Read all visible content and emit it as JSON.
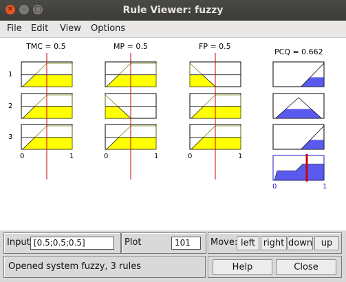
{
  "window": {
    "title": "Rule Viewer: fuzzy"
  },
  "menu": [
    "File",
    "Edit",
    "View",
    "Options"
  ],
  "inputs": [
    {
      "label": "TMC = 0.5",
      "value": 0.5
    },
    {
      "label": "MP = 0.5",
      "value": 0.5
    },
    {
      "label": "FP = 0.5",
      "value": 0.5
    }
  ],
  "output": {
    "label": "PCQ = 0.662",
    "value": 0.662
  },
  "rules": [
    "1",
    "2",
    "3"
  ],
  "axis_ticks": [
    "0",
    "1"
  ],
  "output_ticks": [
    "0",
    "1"
  ],
  "membership": {
    "input_mf_by_rule": [
      [
        "rising",
        "rising",
        "falling"
      ],
      [
        "rising",
        "falling",
        "rising"
      ],
      [
        "rising",
        "rising",
        "rising"
      ]
    ],
    "output_mf_by_rule": [
      "high",
      "mid",
      "high"
    ]
  },
  "colors": {
    "input_fill": "#ffff00",
    "output_fill": "#5a5aee",
    "marker": "#cc0000",
    "output_axis": "#1515c8"
  },
  "bottom": {
    "input_label": "Input",
    "input_value": "[0.5;0.5;0.5]",
    "plot_label": "Plot",
    "plot_value": "101",
    "move_label": "Move:",
    "left": "left",
    "right": "right",
    "down": "down",
    "up": "up",
    "status": "Opened system fuzzy, 3 rules",
    "help": "Help",
    "close": "Close"
  }
}
